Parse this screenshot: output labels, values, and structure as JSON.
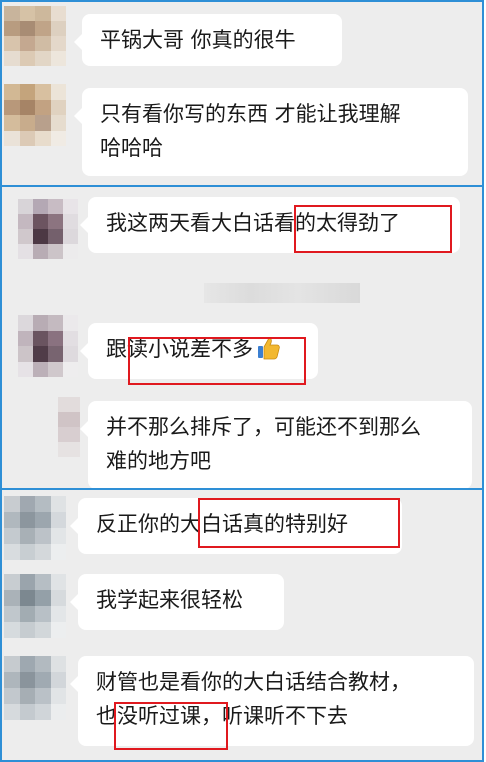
{
  "messages": [
    {
      "lines": [
        "平锅大哥 你真的很牛"
      ]
    },
    {
      "lines": [
        "只有看你写的东西 才能让我理解",
        "哈哈哈"
      ]
    },
    {
      "lines": [
        "我这两天看大白话看的太得劲了"
      ]
    },
    {
      "lines": [
        "跟读小说差不多"
      ],
      "icon": "thumbs-up-icon"
    },
    {
      "lines": [
        "并不那么排斥了，可能还不到那么",
        "难的地方吧"
      ]
    },
    {
      "lines": [
        "反正你的大白话真的特别好"
      ]
    },
    {
      "lines": [
        "我学起来很轻松"
      ]
    },
    {
      "lines": [
        "财管也是看你的大白话结合教材，",
        "也没听过课，听课听不下去"
      ]
    }
  ],
  "colors": {
    "panel_background": "#ededed",
    "panel_border": "#2e8fd6",
    "highlight_border": "#e0191f",
    "bubble": "#ffffff"
  }
}
